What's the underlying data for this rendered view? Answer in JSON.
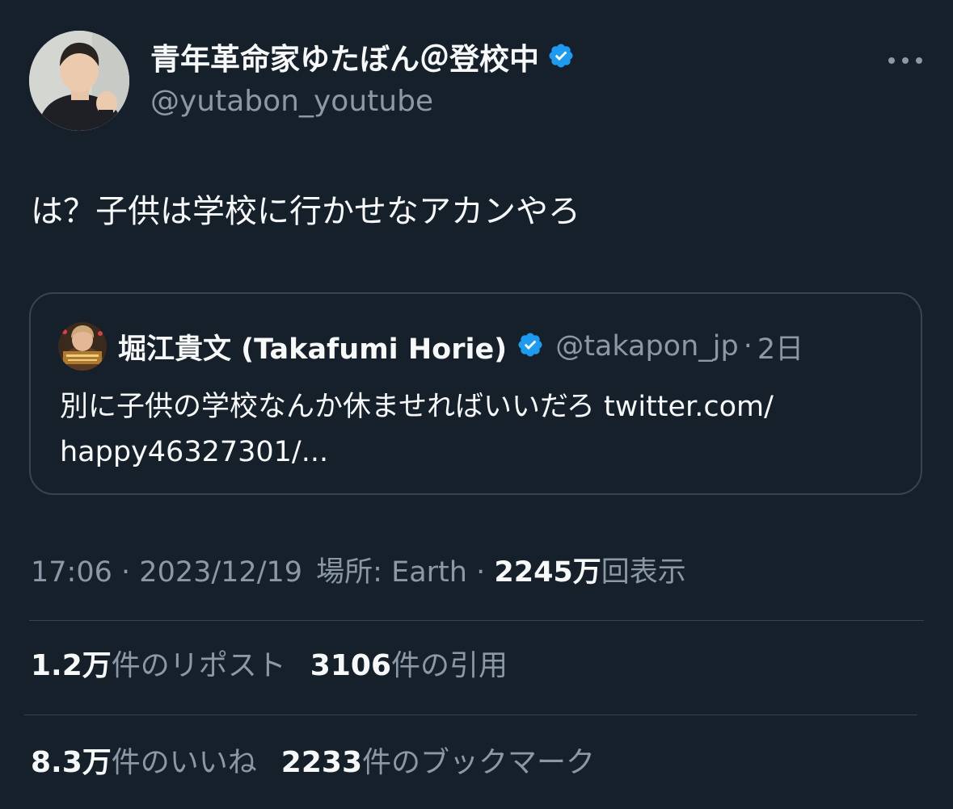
{
  "tweet": {
    "author": {
      "display_name": "青年革命家ゆたぼん＠登校中",
      "handle": "@yutabon_youtube",
      "verified": true
    },
    "text": "は？子供は学校に行かせなアカンやろ",
    "quoted": {
      "display_name": "堀江貴文 (Takafumi Horie)",
      "handle": "@takapon_jp",
      "separator": "·",
      "age": "2日",
      "verified": true,
      "text": "別に子供の学校なんか休ませればいいだろ twitter.com/\nhappy46327301/..."
    },
    "meta": {
      "time": "17:06",
      "sep1": "·",
      "date": "2023/12/19",
      "location": "場所: Earth",
      "sep2": "·",
      "views_number": "2245万",
      "views_label": "回表示"
    },
    "stats": {
      "reposts_number": "1.2万",
      "reposts_label": "件のリポスト",
      "quotes_number": "3106",
      "quotes_label": "件の引用",
      "likes_number": "8.3万",
      "likes_label": "件のいいね",
      "bookmarks_number": "2233",
      "bookmarks_label": "件のブックマーク"
    }
  },
  "colors": {
    "background": "#15202B",
    "text_primary": "#F7F9F9",
    "text_secondary": "#8B98A5",
    "border": "#38444D",
    "verified_blue": "#1D9BF0"
  },
  "icons": {
    "verified": "verified-badge-icon",
    "more": "more-options-icon"
  }
}
